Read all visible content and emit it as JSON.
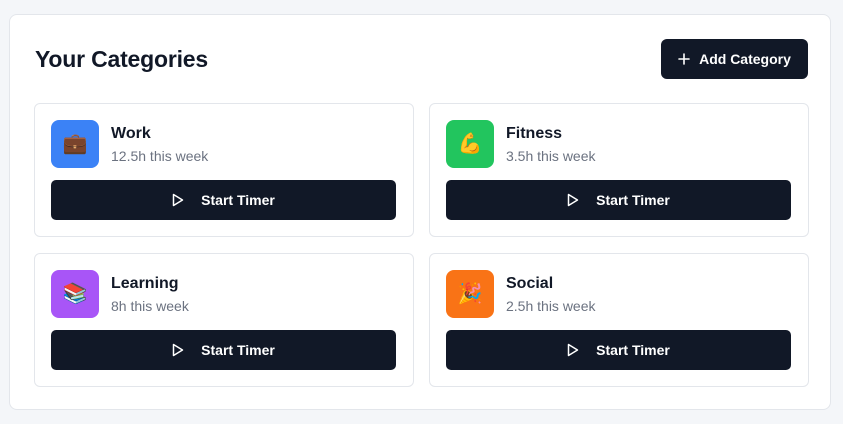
{
  "header": {
    "title": "Your Categories",
    "add_button_label": "Add Category"
  },
  "colors": {
    "primary_dark": "#111827",
    "muted_text": "#6b7280"
  },
  "categories": [
    {
      "name": "Work",
      "time": "12.5h this week",
      "emoji": "💼",
      "icon_name": "briefcase-icon",
      "color": "#3b82f6",
      "button_label": "Start Timer"
    },
    {
      "name": "Fitness",
      "time": "3.5h this week",
      "emoji": "💪",
      "icon_name": "flexed-biceps-icon",
      "color": "#22c55e",
      "button_label": "Start Timer"
    },
    {
      "name": "Learning",
      "time": "8h this week",
      "emoji": "📚",
      "icon_name": "books-icon",
      "color": "#a855f7",
      "button_label": "Start Timer"
    },
    {
      "name": "Social",
      "time": "2.5h this week",
      "emoji": "🎉",
      "icon_name": "party-popper-icon",
      "color": "#f97316",
      "button_label": "Start Timer"
    }
  ]
}
